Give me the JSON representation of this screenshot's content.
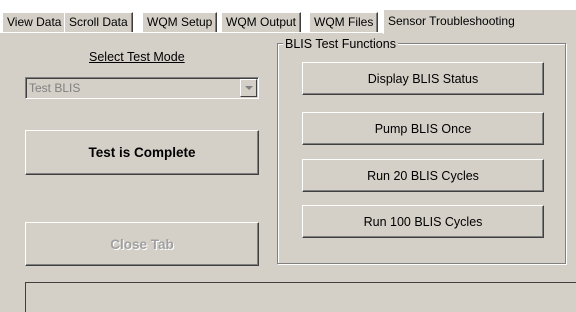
{
  "tabs": [
    {
      "label": "View Data"
    },
    {
      "label": "Scroll Data"
    },
    {
      "label": "WQM Setup"
    },
    {
      "label": "WQM Output"
    },
    {
      "label": "WQM Files"
    },
    {
      "label": "Sensor Troubleshooting"
    }
  ],
  "selected_tab": "Sensor Troubleshooting",
  "left_panel": {
    "select_mode_label": "Select Test Mode",
    "test_mode_value": "Test BLIS",
    "test_complete_button": "Test is Complete",
    "close_tab_button": "Close Tab"
  },
  "blis_group": {
    "title": "BLIS Test Functions",
    "buttons": [
      {
        "label": "Display BLIS Status"
      },
      {
        "label": "Pump BLIS Once"
      },
      {
        "label": "Run 20 BLIS Cycles"
      },
      {
        "label": "Run 100 BLIS Cycles"
      }
    ]
  },
  "colors": {
    "face": "#d4d0c8",
    "highlight": "#ffffff",
    "shadow": "#808080",
    "dark_shadow": "#404040",
    "disabled_text": "#a0a0a0"
  }
}
